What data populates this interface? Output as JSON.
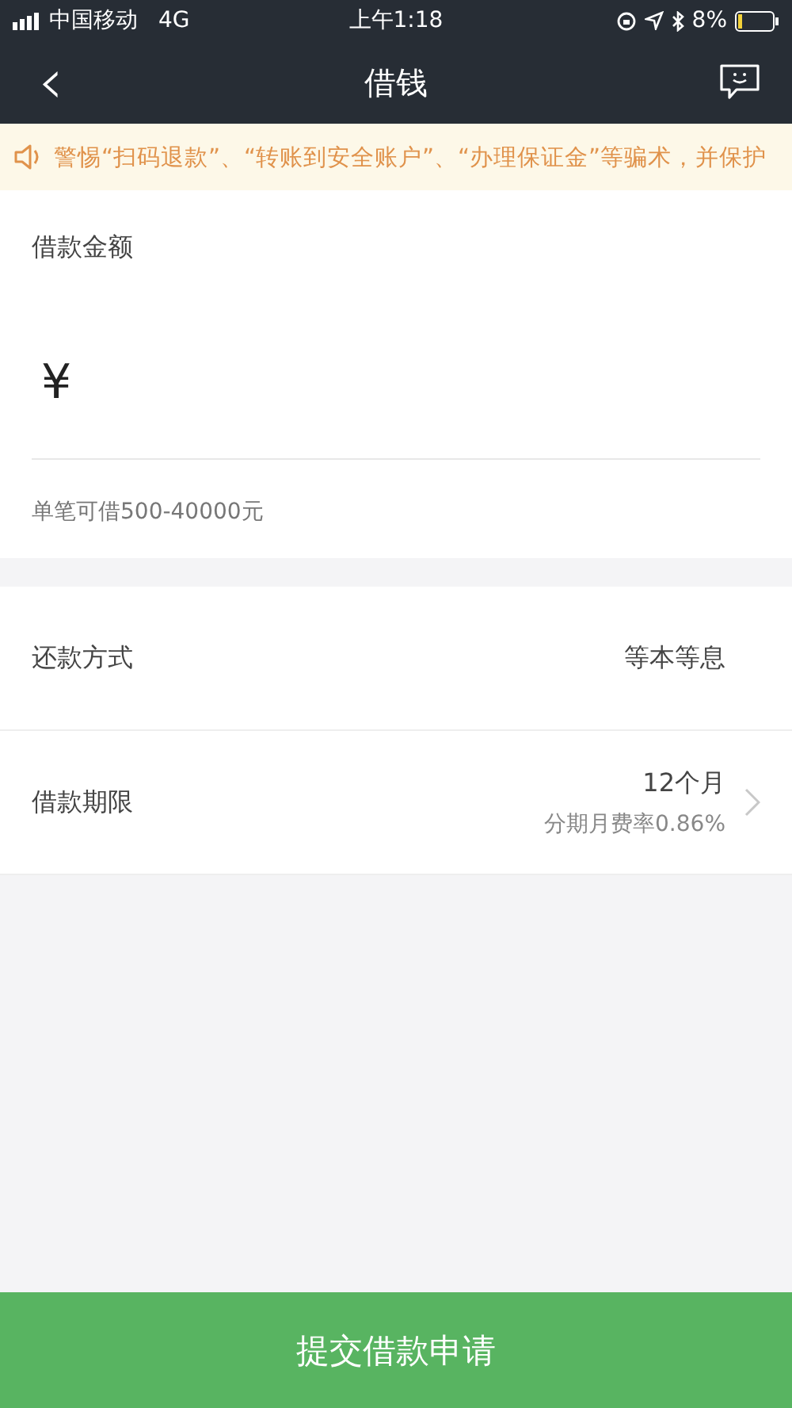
{
  "status_bar": {
    "carrier": "中国移动",
    "network": "4G",
    "time": "上午1:18",
    "battery": "8%"
  },
  "nav": {
    "back": "‹",
    "title": "借钱"
  },
  "notice": {
    "text": "警惕“扫码退款”、“转账到安全账户”、“办理保证金”等骗术，并保护"
  },
  "amount": {
    "label": "借款金额",
    "currency": "¥",
    "hint": "单笔可借500-40000元"
  },
  "rows": [
    {
      "label": "还款方式",
      "value": "等本等息",
      "chevron": false
    },
    {
      "label": "借款期限",
      "value": "12个月",
      "sub": "分期月费率0.86%",
      "chevron": true
    }
  ],
  "submit": {
    "label": "提交借款申请"
  }
}
